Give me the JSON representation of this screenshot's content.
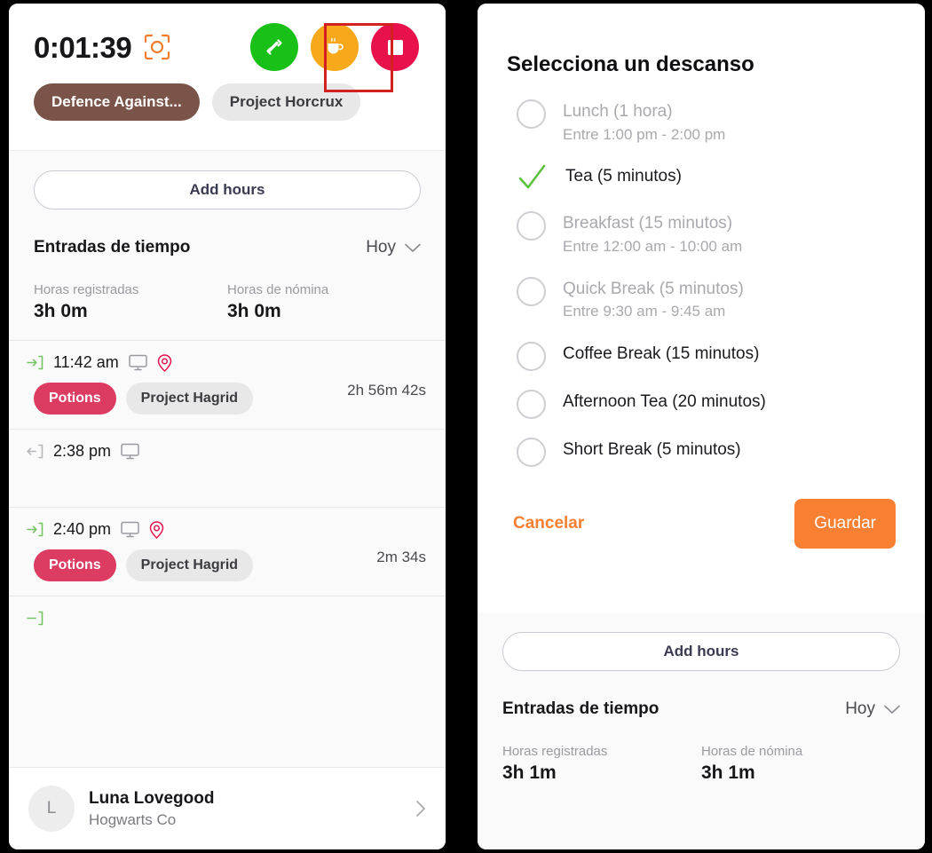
{
  "left_panel": {
    "timer": {
      "value": "0:01:39",
      "focus_icon": "screenshot-frame-icon",
      "controls": [
        {
          "name": "switch-task-button",
          "icon": "switch-arrows-icon",
          "color": "#18c018"
        },
        {
          "name": "take-break-button",
          "icon": "coffee-cup-icon",
          "color": "#f7a81b",
          "highlighted": true
        },
        {
          "name": "stop-timer-button",
          "icon": "stop-square-icon",
          "color": "#e8114b"
        }
      ],
      "task_chip": "Defence Against...",
      "project_chip": "Project Horcrux"
    },
    "add_hours_label": "Add hours",
    "entries_title": "Entradas de tiempo",
    "range_label": "Hoy",
    "totals": [
      {
        "label": "Horas registradas",
        "value": "3h 0m"
      },
      {
        "label": "Horas de nómina",
        "value": "3h 0m"
      }
    ],
    "entries": [
      {
        "direction": "in",
        "time": "11:42 am",
        "duration": "2h 56m 42s",
        "has_monitor": true,
        "has_location": true,
        "task": "Potions",
        "project": "Project Hagrid"
      },
      {
        "direction": "out",
        "time": "2:38 pm",
        "duration": "",
        "has_monitor": true,
        "has_location": false,
        "task": "",
        "project": ""
      },
      {
        "direction": "in",
        "time": "2:40 pm",
        "duration": "2m 34s",
        "has_monitor": true,
        "has_location": true,
        "task": "Potions",
        "project": "Project Hagrid"
      }
    ],
    "user": {
      "initial": "L",
      "name": "Luna Lovegood",
      "org": "Hogwarts Co"
    }
  },
  "right_panel": {
    "dialog": {
      "title": "Selecciona un descanso",
      "options": [
        {
          "label": "Lunch (1 hora)",
          "sub": "Entre 1:00 pm - 2:00 pm",
          "selected": false,
          "disabled": true
        },
        {
          "label": "Tea (5 minutos)",
          "sub": "",
          "selected": true,
          "disabled": false
        },
        {
          "label": "Breakfast (15 minutos)",
          "sub": "Entre 12:00 am - 10:00 am",
          "selected": false,
          "disabled": true
        },
        {
          "label": "Quick Break (5 minutos)",
          "sub": "Entre 9:30 am - 9:45 am",
          "selected": false,
          "disabled": true
        },
        {
          "label": "Coffee Break (15 minutos)",
          "sub": "",
          "selected": false,
          "disabled": false
        },
        {
          "label": "Afternoon Tea (20 minutos)",
          "sub": "",
          "selected": false,
          "disabled": false
        },
        {
          "label": "Short Break (5 minutos)",
          "sub": "",
          "selected": false,
          "disabled": false
        }
      ],
      "cancel_label": "Cancelar",
      "save_label": "Guardar",
      "accent_color": "#f97f32"
    },
    "add_hours_label": "Add hours",
    "entries_title": "Entradas de tiempo",
    "range_label": "Hoy",
    "totals": [
      {
        "label": "Horas registradas",
        "value": "3h 1m"
      },
      {
        "label": "Horas de nómina",
        "value": "3h 1m"
      }
    ]
  }
}
